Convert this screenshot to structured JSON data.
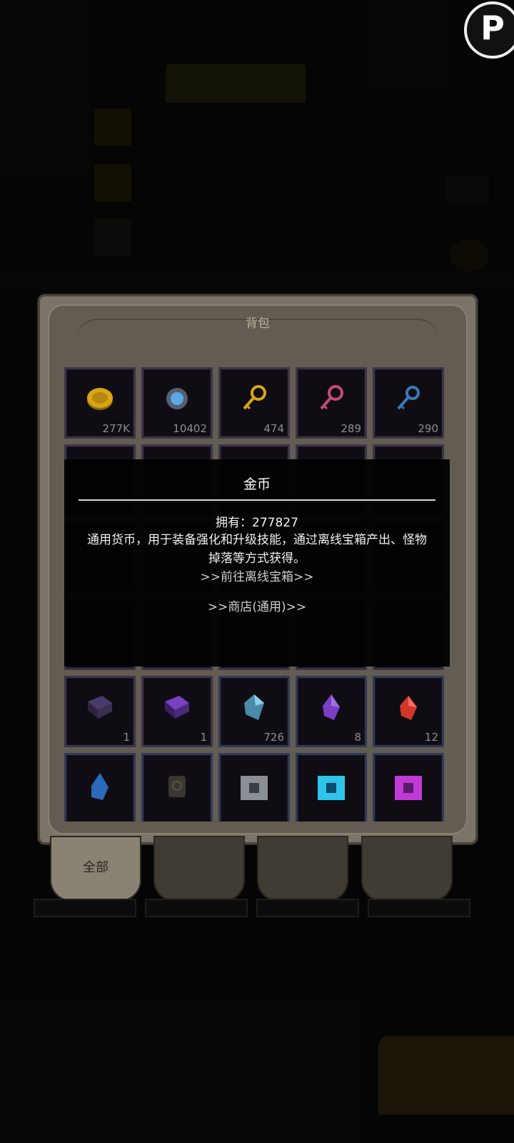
{
  "bag": {
    "title": "背包",
    "items": [
      {
        "icon": "gold-coin-icon",
        "count": "277K"
      },
      {
        "icon": "blue-gem-medal-icon",
        "count": "10402"
      },
      {
        "icon": "gold-key-icon",
        "count": "474"
      },
      {
        "icon": "pink-key-icon",
        "count": "289"
      },
      {
        "icon": "blue-key-icon",
        "count": "290"
      },
      {
        "icon": "purple-book-icon",
        "count": "1"
      },
      {
        "icon": "violet-book-icon",
        "count": "1"
      },
      {
        "icon": "blue-crystal-icon",
        "count": "726"
      },
      {
        "icon": "purple-crystal-icon",
        "count": "8"
      },
      {
        "icon": "red-crystal-icon",
        "count": "12"
      },
      {
        "icon": "blue-shard-icon",
        "count": ""
      },
      {
        "icon": "scroll-icon",
        "count": ""
      },
      {
        "icon": "gray-puzzle-icon",
        "count": ""
      },
      {
        "icon": "cyan-puzzle-icon",
        "count": ""
      },
      {
        "icon": "magenta-puzzle-icon",
        "count": ""
      }
    ]
  },
  "categories": {
    "all": "全部"
  },
  "tooltip": {
    "title": "金币",
    "owned": "拥有：277827",
    "description": "通用货币，用于装备强化和升级技能，通过离线宝箱产出、怪物掉落等方式获得。",
    "link_offline_chest": ">>前往离线宝箱>>",
    "link_shop": ">>商店(通用)>>"
  },
  "colors": {
    "gold": "#d9a514",
    "blue_crystal": "#5aa9e6",
    "purple": "#7a3fc2",
    "red": "#d2362a",
    "magenta": "#c23ad6",
    "cyan": "#2ec3e8"
  }
}
